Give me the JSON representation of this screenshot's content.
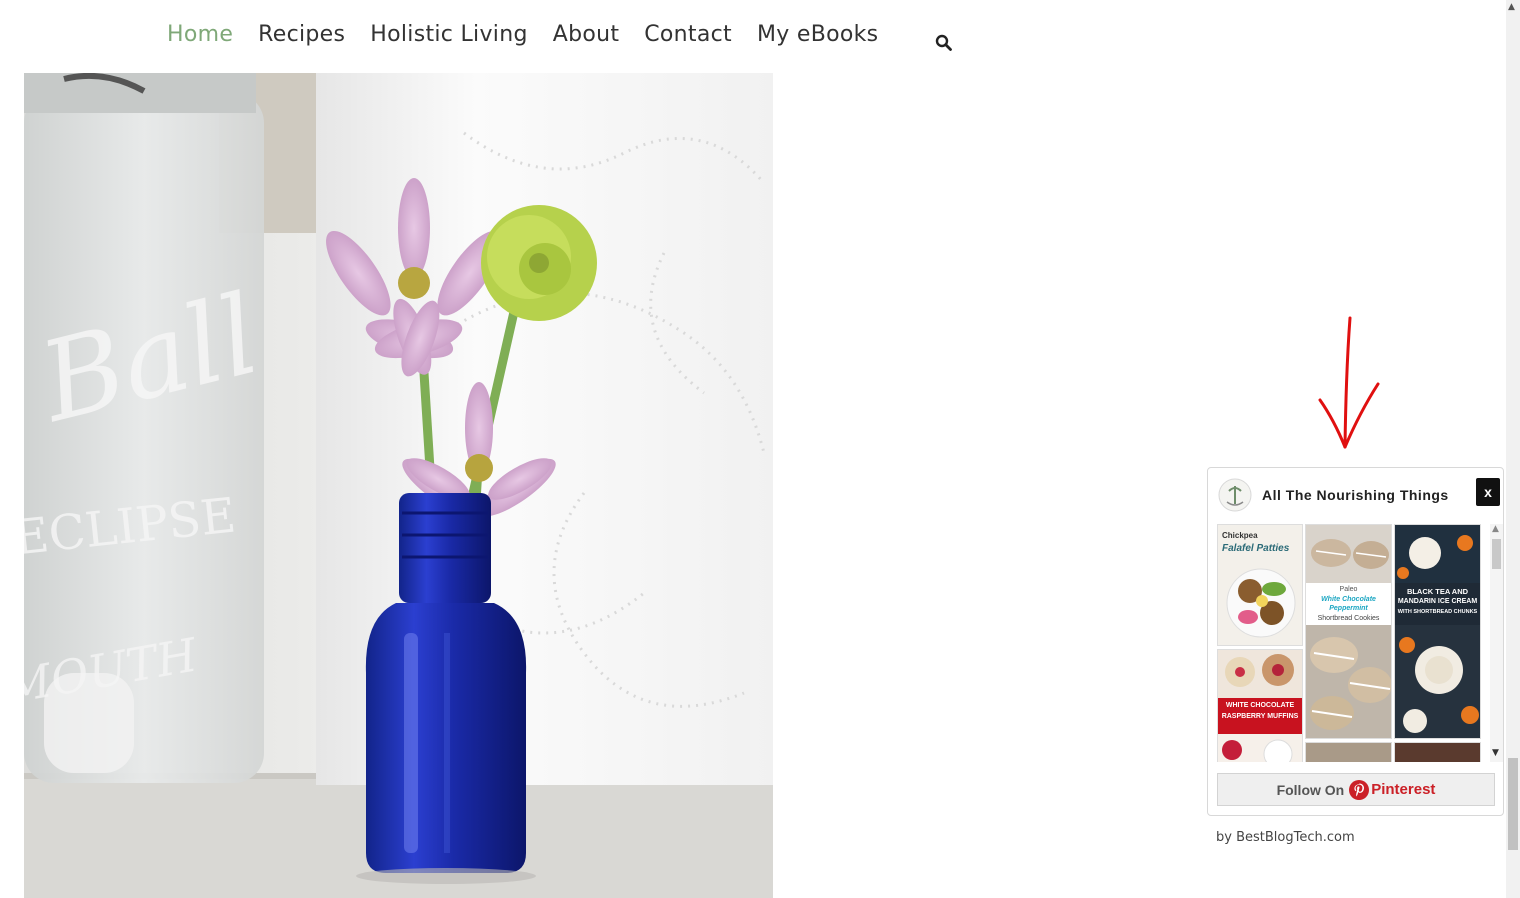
{
  "nav": {
    "items": [
      {
        "label": "Home",
        "active": true
      },
      {
        "label": "Recipes",
        "active": false
      },
      {
        "label": "Holistic Living",
        "active": false
      },
      {
        "label": "About",
        "active": false
      },
      {
        "label": "Contact",
        "active": false
      },
      {
        "label": "My eBooks",
        "active": false
      }
    ],
    "search_icon": "search-icon",
    "active_color": "#7fa878"
  },
  "hero": {
    "jar_text": "Ball",
    "jar_text_2": "ECLIPSE",
    "jar_text_3": "MOUTH"
  },
  "widget": {
    "title": "All The Nourishing Things",
    "close_label": "x",
    "pins": [
      {
        "line1": "Chickpea",
        "line2": "Falafel Patties"
      },
      {
        "line1": "Paleo",
        "line2": "White Chocolate Peppermint",
        "line3": "Shortbread Cookies"
      },
      {
        "line1": "BLACK TEA AND",
        "line2": "MANDARIN ICE CREAM",
        "line3": "WITH SHORTBREAD CHUNKS"
      },
      {
        "line1": "WHITE CHOCOLATE",
        "line2": "RASPBERRY MUFFINS"
      }
    ],
    "follow_label": "Follow On",
    "pinterest_label": "Pinterest",
    "credit": "by BestBlogTech.com",
    "brand_color": "#cb2027"
  },
  "annotation": {
    "color": "#e01010"
  }
}
